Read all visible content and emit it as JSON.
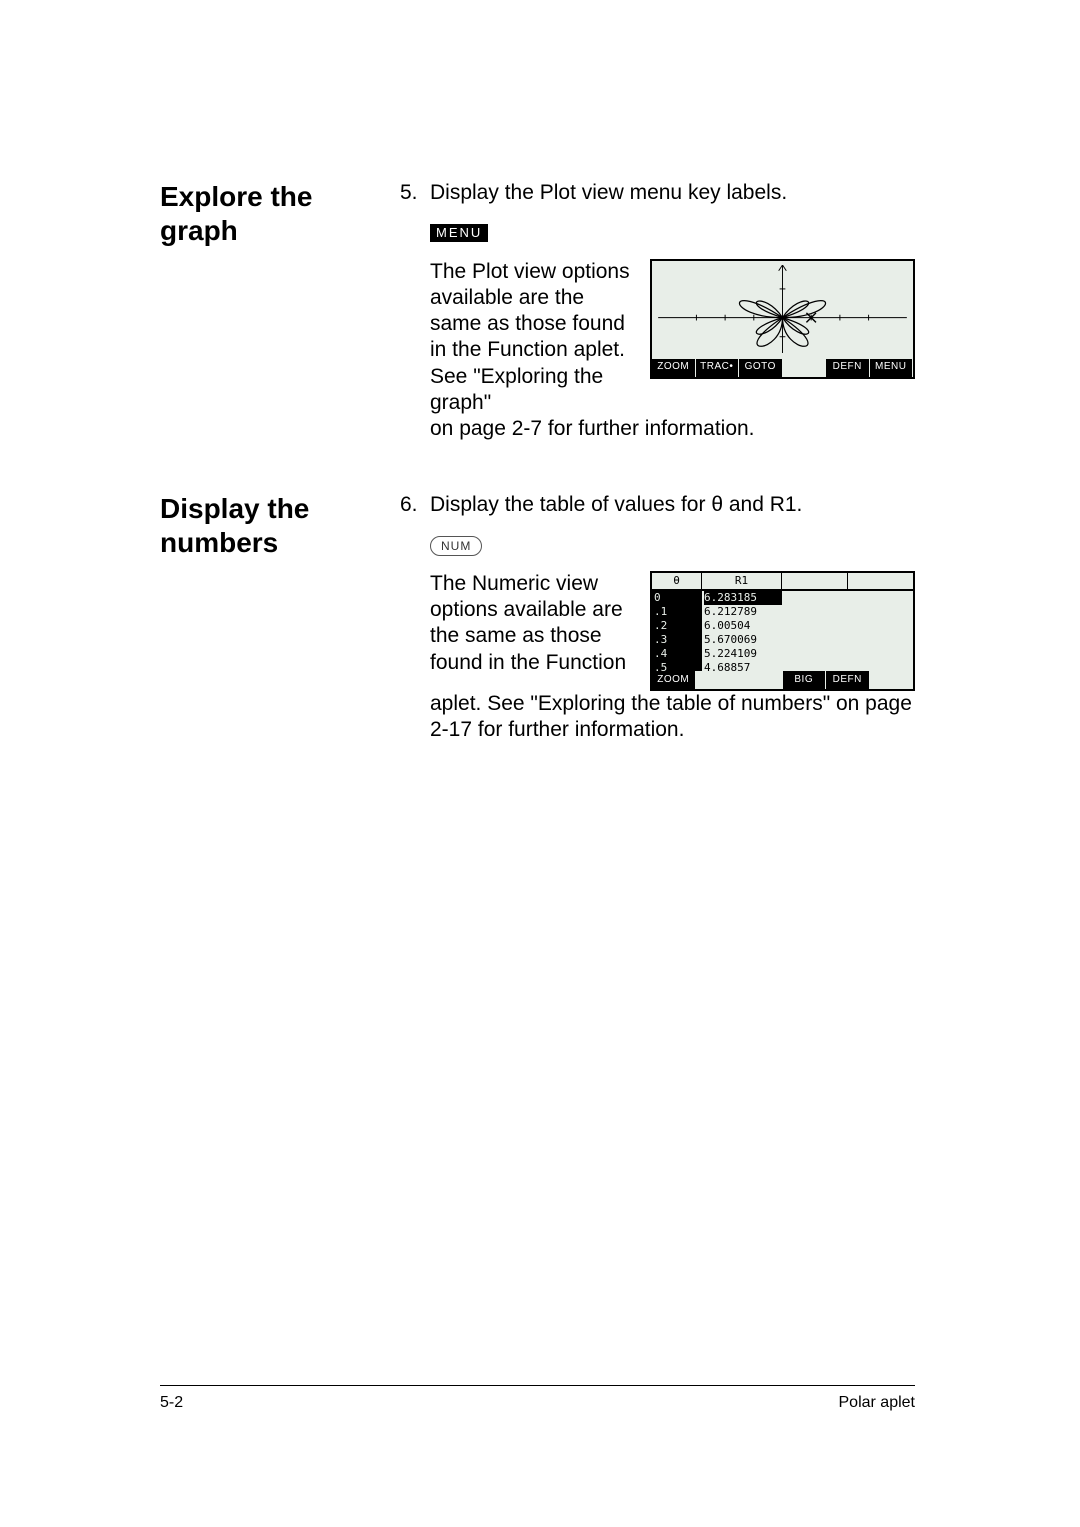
{
  "section1": {
    "heading": "Explore the graph",
    "step_num": "5.",
    "step_text": "Display the Plot view menu key labels.",
    "key_label": "MENU",
    "body_text_left": "The Plot view options available are the same as those found in the Function aplet. See \"Exploring the graph\"",
    "body_text_below": "on page 2-7 for further information.",
    "plot_menu": [
      "ZOOM",
      "TRAC•",
      "GOTO",
      "",
      "DEFN",
      "MENU"
    ]
  },
  "section2": {
    "heading": "Display the numbers",
    "step_num": "6.",
    "step_text": "Display the table of values for θ and R1.",
    "key_label": "NUM",
    "body_text_left": "The Numeric view options available are the same as those found in the Function",
    "body_text_below": "aplet. See \"Exploring the table of numbers\" on page 2-17 for further information.",
    "table": {
      "cols": [
        "θ",
        "R1",
        "",
        ""
      ],
      "theta_vals": [
        "0",
        ".1",
        ".2",
        ".3",
        ".4",
        ".5"
      ],
      "r1_vals": [
        "6.283185",
        "6.212789",
        "6.00504",
        "5.670069",
        "5.224109",
        "4.68857"
      ],
      "current": "0",
      "menu": [
        "ZOOM",
        "",
        "",
        "BIG",
        "DEFN",
        ""
      ]
    }
  },
  "footer": {
    "page": "5-2",
    "title": "Polar aplet"
  }
}
